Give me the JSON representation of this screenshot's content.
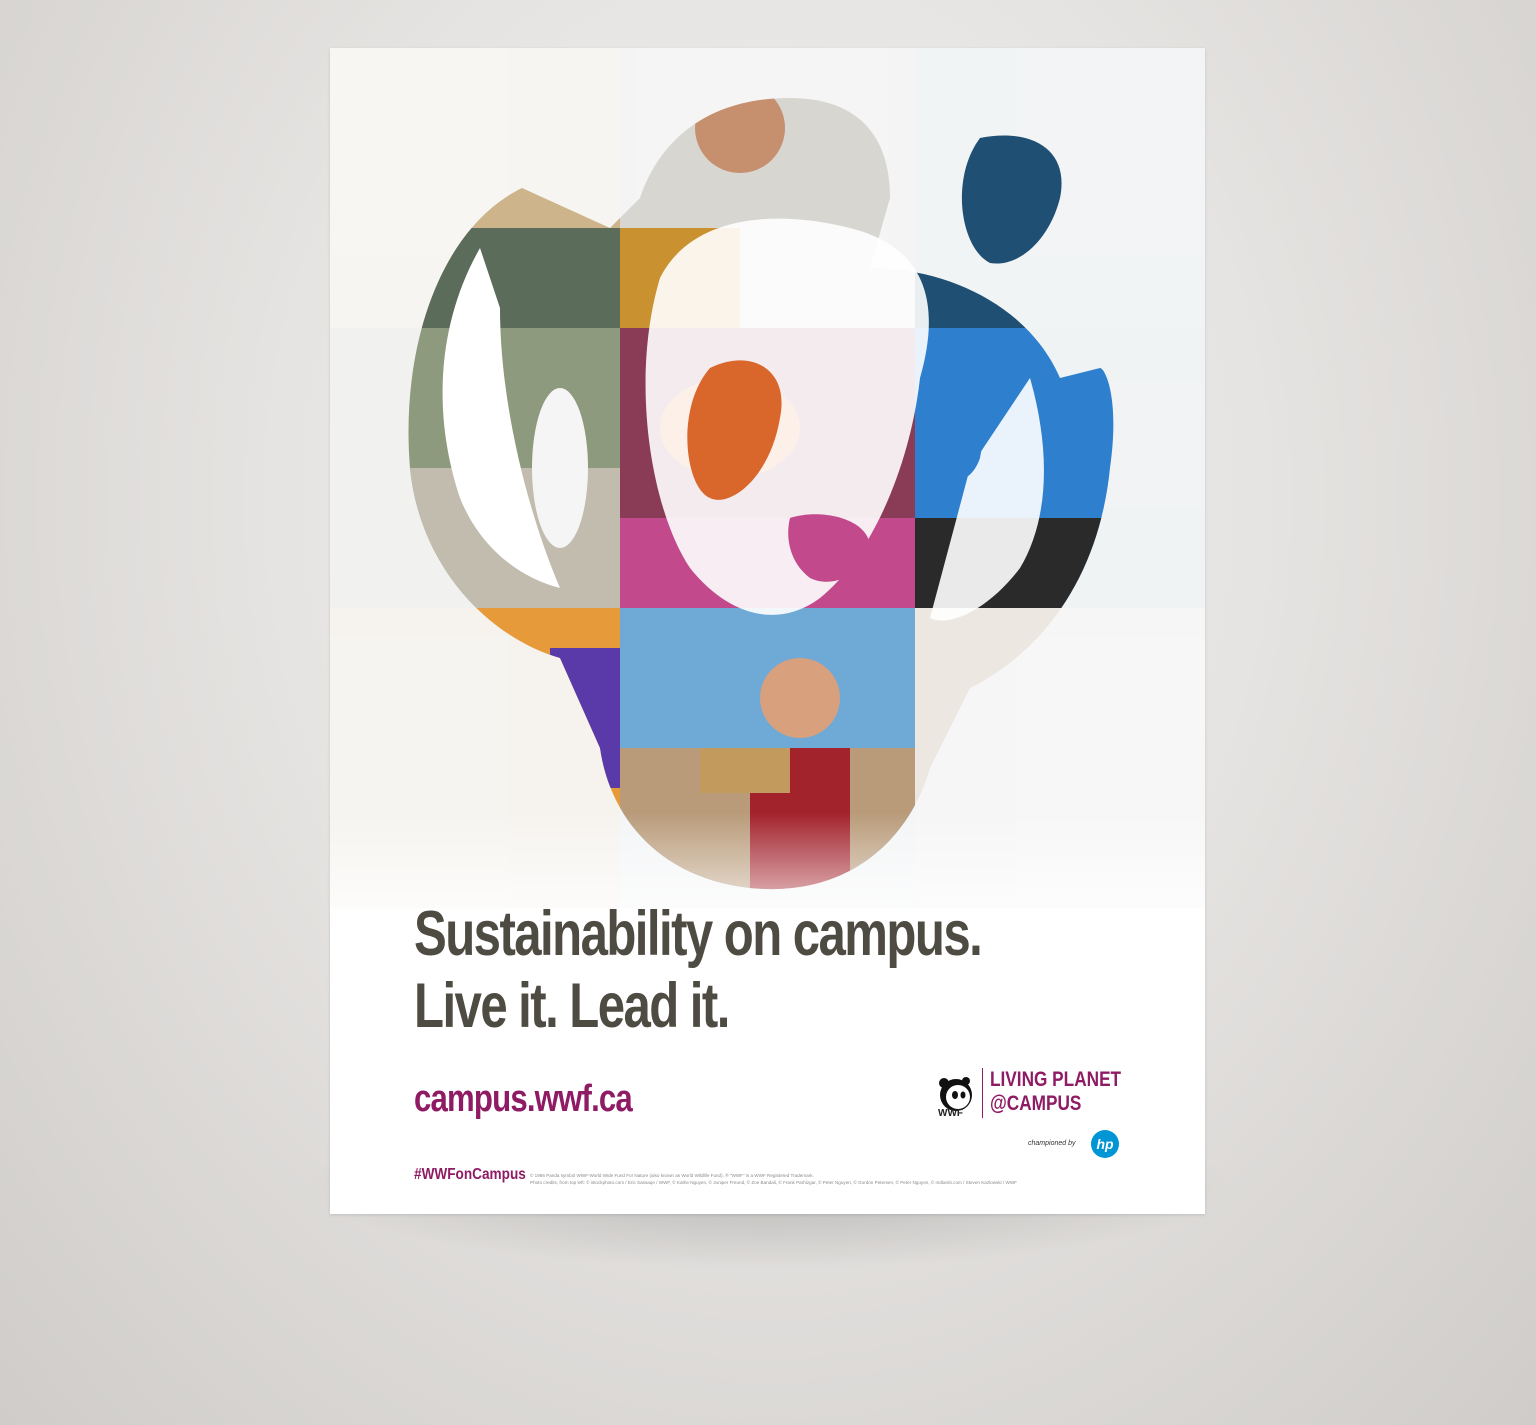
{
  "poster": {
    "headline_line1": "Sustainability on campus.",
    "headline_line2": "Live it. Lead it.",
    "url": "campus.wwf.ca",
    "hashtag": "#WWFonCampus",
    "fineprint_line1": "© 1986 Panda symbol WWF-World Wide Fund For Nature (also known as World Wildlife Fund). ® \"WWF\" is a WWF Registered Trademark.",
    "fineprint_line2": "Photo credits, from top left: © istockphoto.com / Eric Sassaqe / WWF, © Kathe Nguyen, © Juniper Freund, © Zoe Bandali, © Frank Parhizgar, © Peter Nguyen, © Gordon Petersen, © Peter Nguyen, © mdlamb.com / Steven Kazlowski / WWF"
  },
  "logo": {
    "wwf": "WWF",
    "line1": "LIVING PLANET",
    "line2": "@CAMPUS",
    "championed": "championed by",
    "hp": "hp"
  },
  "colors": {
    "accent": "#8e1b64",
    "headline": "#4e4b42",
    "hp_blue": "#0096d6"
  },
  "photo_panels": [
    "coastline-photo",
    "beekeeper-photo",
    "whale-photo",
    "hikers-photo",
    "butterfly-photo",
    "kites-photo",
    "hummingbird-photo",
    "students-clipboard-photo",
    "polar-bear-photo"
  ]
}
